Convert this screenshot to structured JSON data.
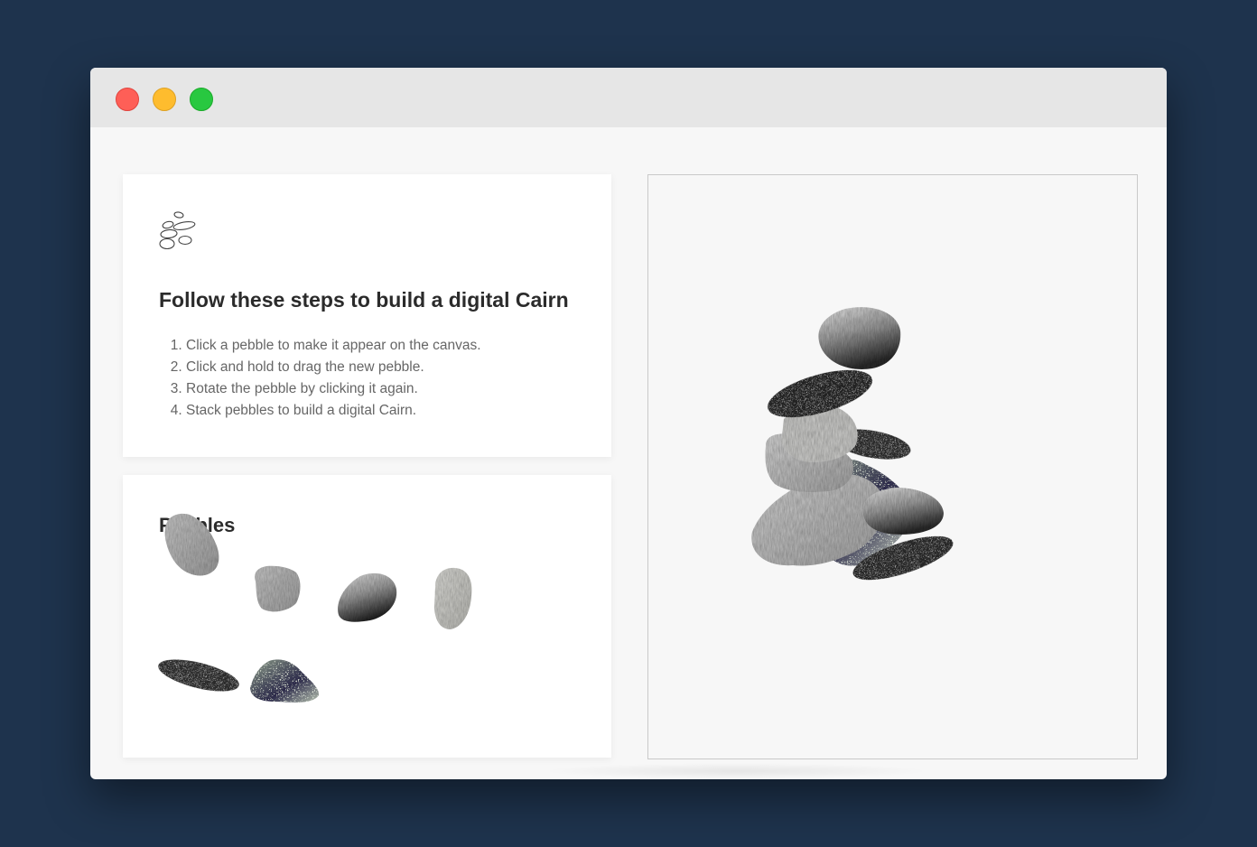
{
  "window": {
    "controls": [
      "close",
      "minimize",
      "maximize"
    ]
  },
  "instructions": {
    "icon": "pebbles-icon",
    "title": "Follow these steps to build a digital Cairn",
    "steps": [
      "Click a pebble to make it appear on the canvas.",
      "Click and hold to drag the new pebble.",
      "Rotate the pebble by clicking it again.",
      "Stack pebbles to build a digital Cairn."
    ]
  },
  "palette": {
    "title": "Pebbles",
    "items": [
      {
        "name": "grey-angular-pebble",
        "texture": "granite-light"
      },
      {
        "name": "grey-flat-pebble",
        "texture": "granite-light"
      },
      {
        "name": "dark-gradient-pebble",
        "texture": "dark-gradient"
      },
      {
        "name": "pale-oval-pebble",
        "texture": "pale"
      },
      {
        "name": "speckled-long-pebble",
        "texture": "speckled"
      },
      {
        "name": "mossy-pebble",
        "texture": "mossy"
      }
    ]
  },
  "colors": {
    "background": "#1e334d",
    "window": "#f7f7f7",
    "titlebar": "#e6e6e6",
    "close": "#fe5f57",
    "minimize": "#febc2e",
    "maximize": "#28c840"
  }
}
